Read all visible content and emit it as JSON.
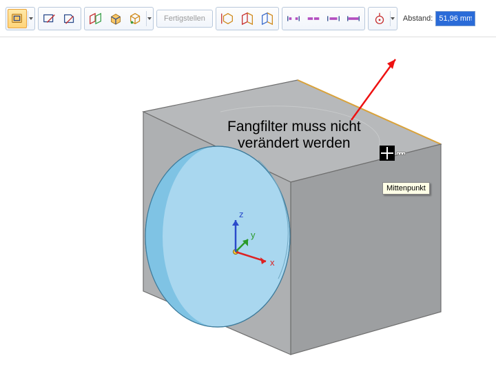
{
  "toolbar": {
    "finish_label": "Fertigstellen",
    "distance_label": "Abstand:",
    "distance_value": "51,96 mm"
  },
  "annotation": {
    "line1": "Fangfilter muss nicht",
    "line2": "verändert werden"
  },
  "snap_tooltip": "Mittenpunkt",
  "axes": {
    "x": "x",
    "y": "y",
    "z": "z"
  },
  "icons": {
    "plane_active": "coincident-plane-icon",
    "sketch": "sketch-icon",
    "edit": "edit-plane-icon",
    "parallel": "parallel-plane-icon",
    "box": "box-icon",
    "multi": "multiface-icon",
    "axis": "axis-face-icon",
    "face_red": "plane-face-icon",
    "face_blue": "plane-back-icon",
    "tab_a": "extent-a-icon",
    "tab_b": "extent-b-icon",
    "tab_c": "extent-c-icon",
    "tab_d": "extent-d-icon",
    "snap": "snap-center-icon"
  }
}
